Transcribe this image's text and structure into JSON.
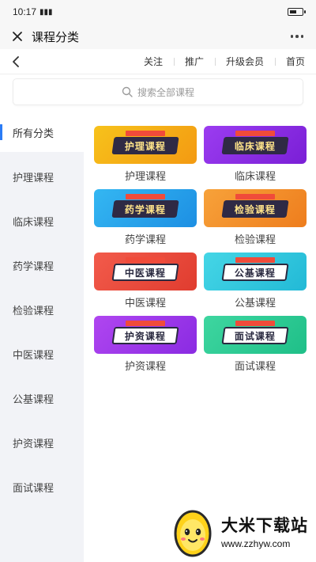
{
  "status_bar": {
    "time": "10:17",
    "signal": "⁺¹⁰ෞᴴᴰ"
  },
  "title_bar": {
    "title": "课程分类"
  },
  "nav": {
    "links": [
      "关注",
      "推广",
      "升级会员",
      "首页"
    ]
  },
  "search": {
    "placeholder": "搜索全部课程"
  },
  "sidebar": {
    "items": [
      {
        "label": "所有分类",
        "active": true
      },
      {
        "label": "护理课程"
      },
      {
        "label": "临床课程"
      },
      {
        "label": "药学课程"
      },
      {
        "label": "检验课程"
      },
      {
        "label": "中医课程"
      },
      {
        "label": "公基课程"
      },
      {
        "label": "护资课程"
      },
      {
        "label": "面试课程"
      }
    ]
  },
  "courses": [
    {
      "banner_text": "护理课程",
      "label": "护理课程",
      "color_a": "#f7c21b",
      "color_b": "#f39a12",
      "style": "a"
    },
    {
      "banner_text": "临床课程",
      "label": "临床课程",
      "color_a": "#9b3cf0",
      "color_b": "#7a1fd6",
      "style": "a"
    },
    {
      "banner_text": "药学课程",
      "label": "药学课程",
      "color_a": "#34b7f2",
      "color_b": "#1d8fe3",
      "style": "a"
    },
    {
      "banner_text": "检验课程",
      "label": "检验课程",
      "color_a": "#f7a23a",
      "color_b": "#ee7d1d",
      "style": "a"
    },
    {
      "banner_text": "中医课程",
      "label": "中医课程",
      "color_a": "#f25b4b",
      "color_b": "#e03c2f",
      "style": "b"
    },
    {
      "banner_text": "公基课程",
      "label": "公基课程",
      "color_a": "#45d6e6",
      "color_b": "#22b9d6",
      "style": "b"
    },
    {
      "banner_text": "护资课程",
      "label": "护资课程",
      "color_a": "#b046f0",
      "color_b": "#8a2be2",
      "style": "b"
    },
    {
      "banner_text": "面试课程",
      "label": "面试课程",
      "color_a": "#3ed6a0",
      "color_b": "#1fbf88",
      "style": "b"
    }
  ],
  "watermark": {
    "name": "大米下载站",
    "url": "www.zzhyw.com"
  },
  "colors": {
    "accent": "#2b7cf6",
    "sidebar_bg": "#f2f3f7"
  },
  "icons": {
    "close": "close-icon",
    "more": "more-icon",
    "back": "back-icon",
    "search": "search-icon"
  }
}
